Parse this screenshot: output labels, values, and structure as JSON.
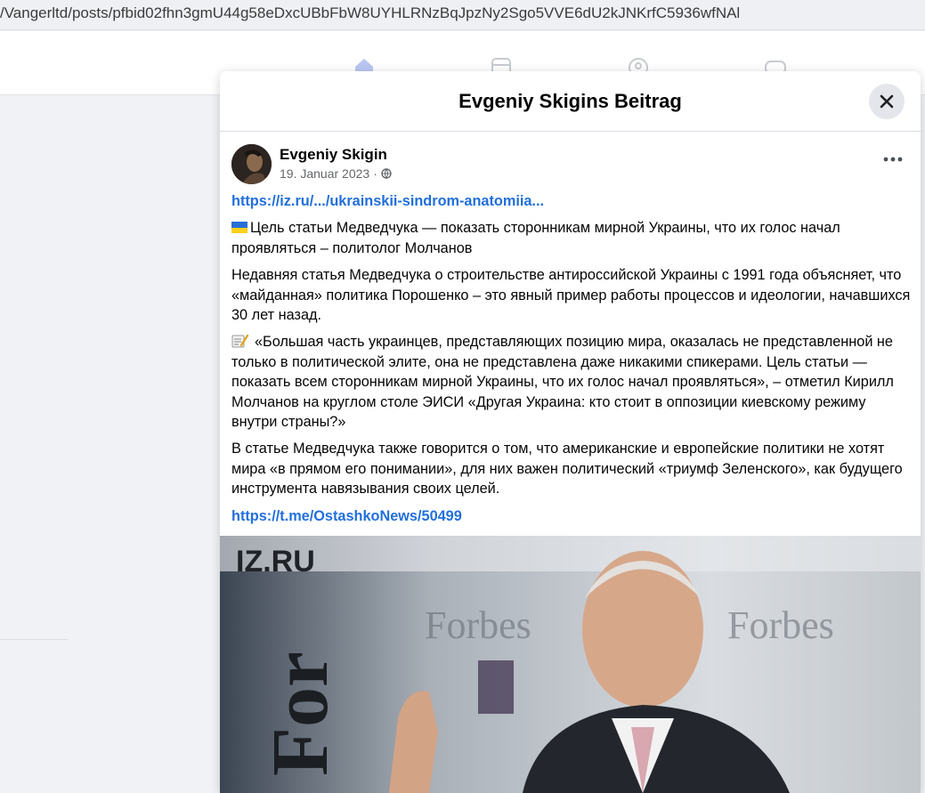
{
  "browser": {
    "url": "/Vangerltd/posts/pfbid02fhn3gmU44g58eDxcUBbFbW8UYHLRNzBqJpzNy2Sgo5VVE6dU2kJNKrfC5936wfNAl"
  },
  "modal": {
    "title": "Evgeniy Skigins Beitrag"
  },
  "post": {
    "author": "Evgeniy Skigin",
    "date": "19. Januar 2023",
    "separator": "·",
    "link_top": "https://iz.ru/.../ukrainskii-sindrom-anatomiia...",
    "p1": "Цель статьи Медведчука — показать сторонникам мирной Украины, что их голос начал проявляться – политолог Молчанов",
    "p2": "Недавняя статья Медведчука о строительстве антироссийской Украины с 1991 года объясняет, что «майданная» политика Порошенко – это явный пример работы процессов и идеологии, начавшихся 30 лет назад.",
    "p3": "«Большая часть украинцев, представляющих позицию мира, оказалась не представленной не только в политической элите, она не представлена даже никакими спикерами. Цель статьи — показать всем сторонникам мирной Украины, что их голос начал проявляться», – отметил Кирилл Молчанов на круглом столе ЭИСИ «Другая Украина: кто стоит в оппозиции киевскому режиму внутри страны?»",
    "p4": "В статье Медведчука также говорится о том, что американские и европейские политики не хотят мира «в прямом его понимании», для них важен политический «триумф Зеленского», как будущего инструмента навязывания своих целей.",
    "link_bottom": "https://t.me/OstashkoNews/50499",
    "photo_texts": [
      "IZ.RU",
      "Forbes",
      "Forbes",
      "For"
    ],
    "icons": {
      "privacy": "globe-icon",
      "p1_prefix": "ukraine-flag-icon",
      "p3_prefix": "memo-icon",
      "more": "more-options-icon",
      "close": "close-icon"
    }
  },
  "colors": {
    "link": "#216fdb",
    "modal_bg": "#ffffff",
    "page_bg": "#f0f2f5",
    "close_bg": "#e4e6eb"
  }
}
